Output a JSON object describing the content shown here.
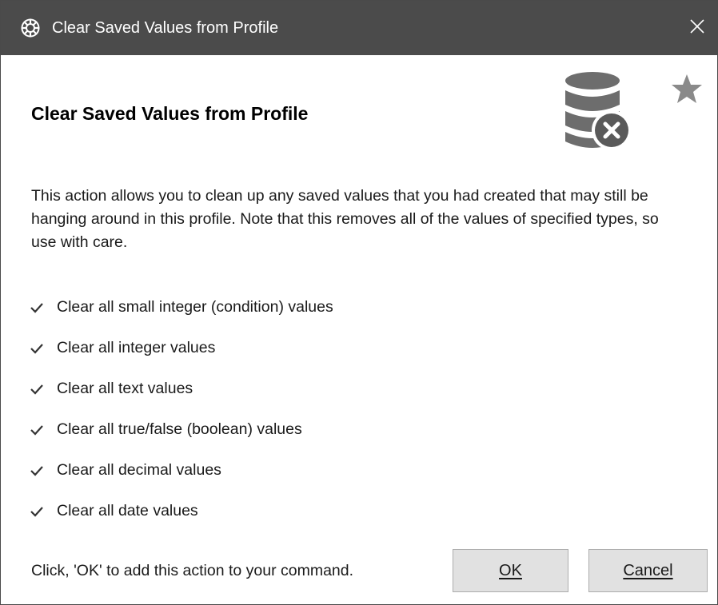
{
  "window": {
    "title": "Clear Saved Values from Profile",
    "icon": "voiceattack-gear-icon",
    "close_icon": "close-icon"
  },
  "header": {
    "heading": "Clear Saved Values from Profile",
    "icon": "database-delete-icon",
    "favorite_icon": "star-icon"
  },
  "description": "This action allows you to clean up any saved values that you had created that may still be hanging around in this profile.  Note that this removes all of the values of specified types, so use with care.",
  "options": [
    {
      "label": "Clear all small integer (condition) values",
      "checked": true
    },
    {
      "label": "Clear all integer values",
      "checked": true
    },
    {
      "label": "Clear all text values",
      "checked": true
    },
    {
      "label": "Clear all true/false (boolean) values",
      "checked": true
    },
    {
      "label": "Clear all decimal values",
      "checked": true
    },
    {
      "label": "Clear all date values",
      "checked": true
    }
  ],
  "footer": {
    "hint": "Click, 'OK' to add this action to your command.",
    "ok_label": "OK",
    "cancel_label": "Cancel"
  },
  "colors": {
    "titlebar": "#4b4b4b",
    "icon_gray": "#6d6d6d",
    "button_bg": "#e1e1e1"
  }
}
